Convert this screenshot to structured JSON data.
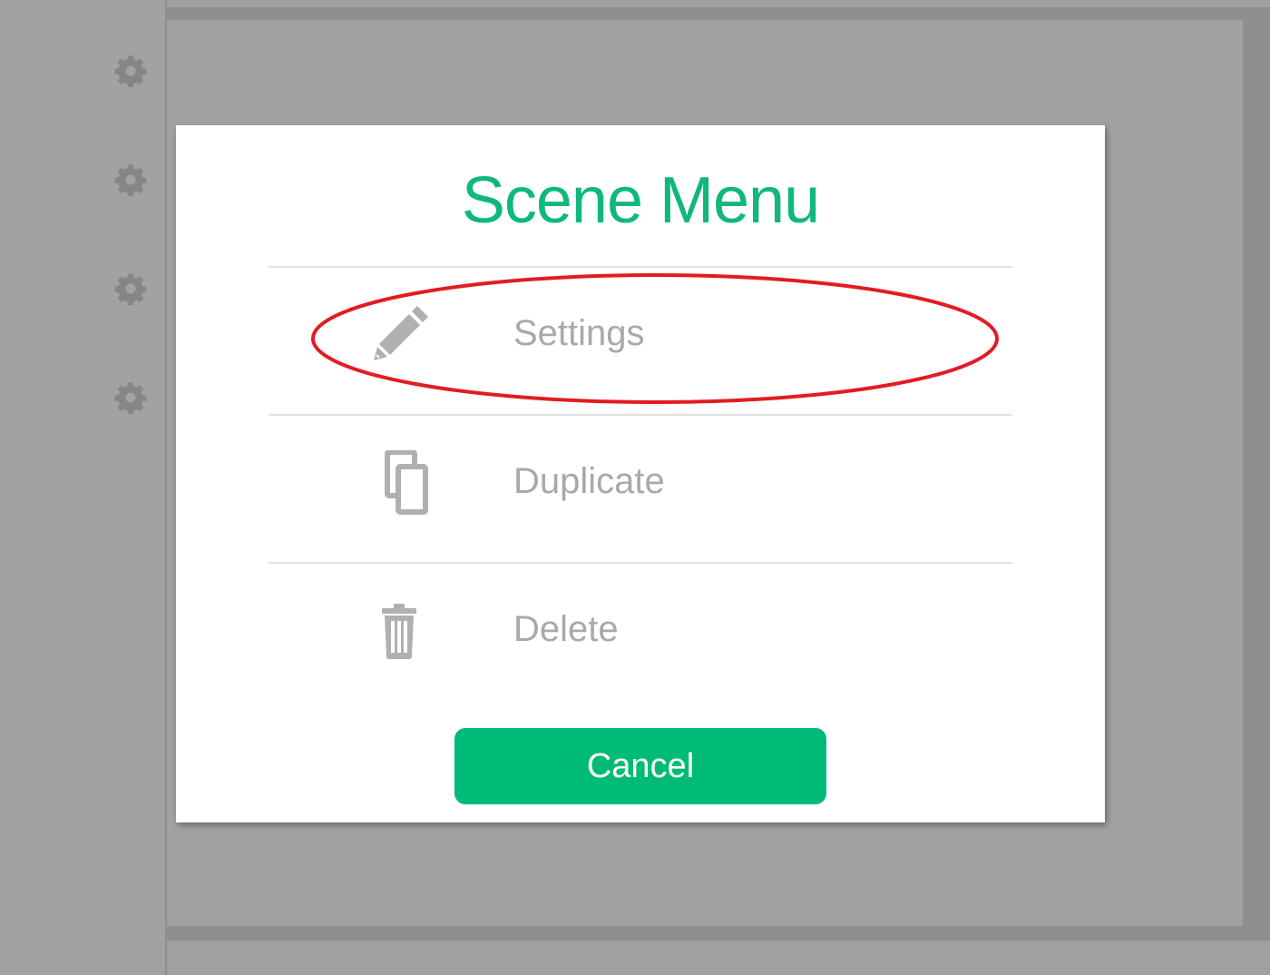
{
  "sidebar": {
    "icons": [
      "gear-icon",
      "gear-icon",
      "gear-icon",
      "gear-icon"
    ]
  },
  "modal": {
    "title": "Scene Menu",
    "items": [
      {
        "label": "Settings",
        "icon": "pencil-icon"
      },
      {
        "label": "Duplicate",
        "icon": "duplicate-icon"
      },
      {
        "label": "Delete",
        "icon": "trash-icon"
      }
    ],
    "cancel_label": "Cancel"
  },
  "colors": {
    "accent": "#10b87a",
    "button": "#00bb77",
    "item_text": "#a9a9a9",
    "overlay": "#a0a0a0",
    "highlight": "#e31b23"
  },
  "annotation": {
    "highlighted_item": "Settings"
  }
}
